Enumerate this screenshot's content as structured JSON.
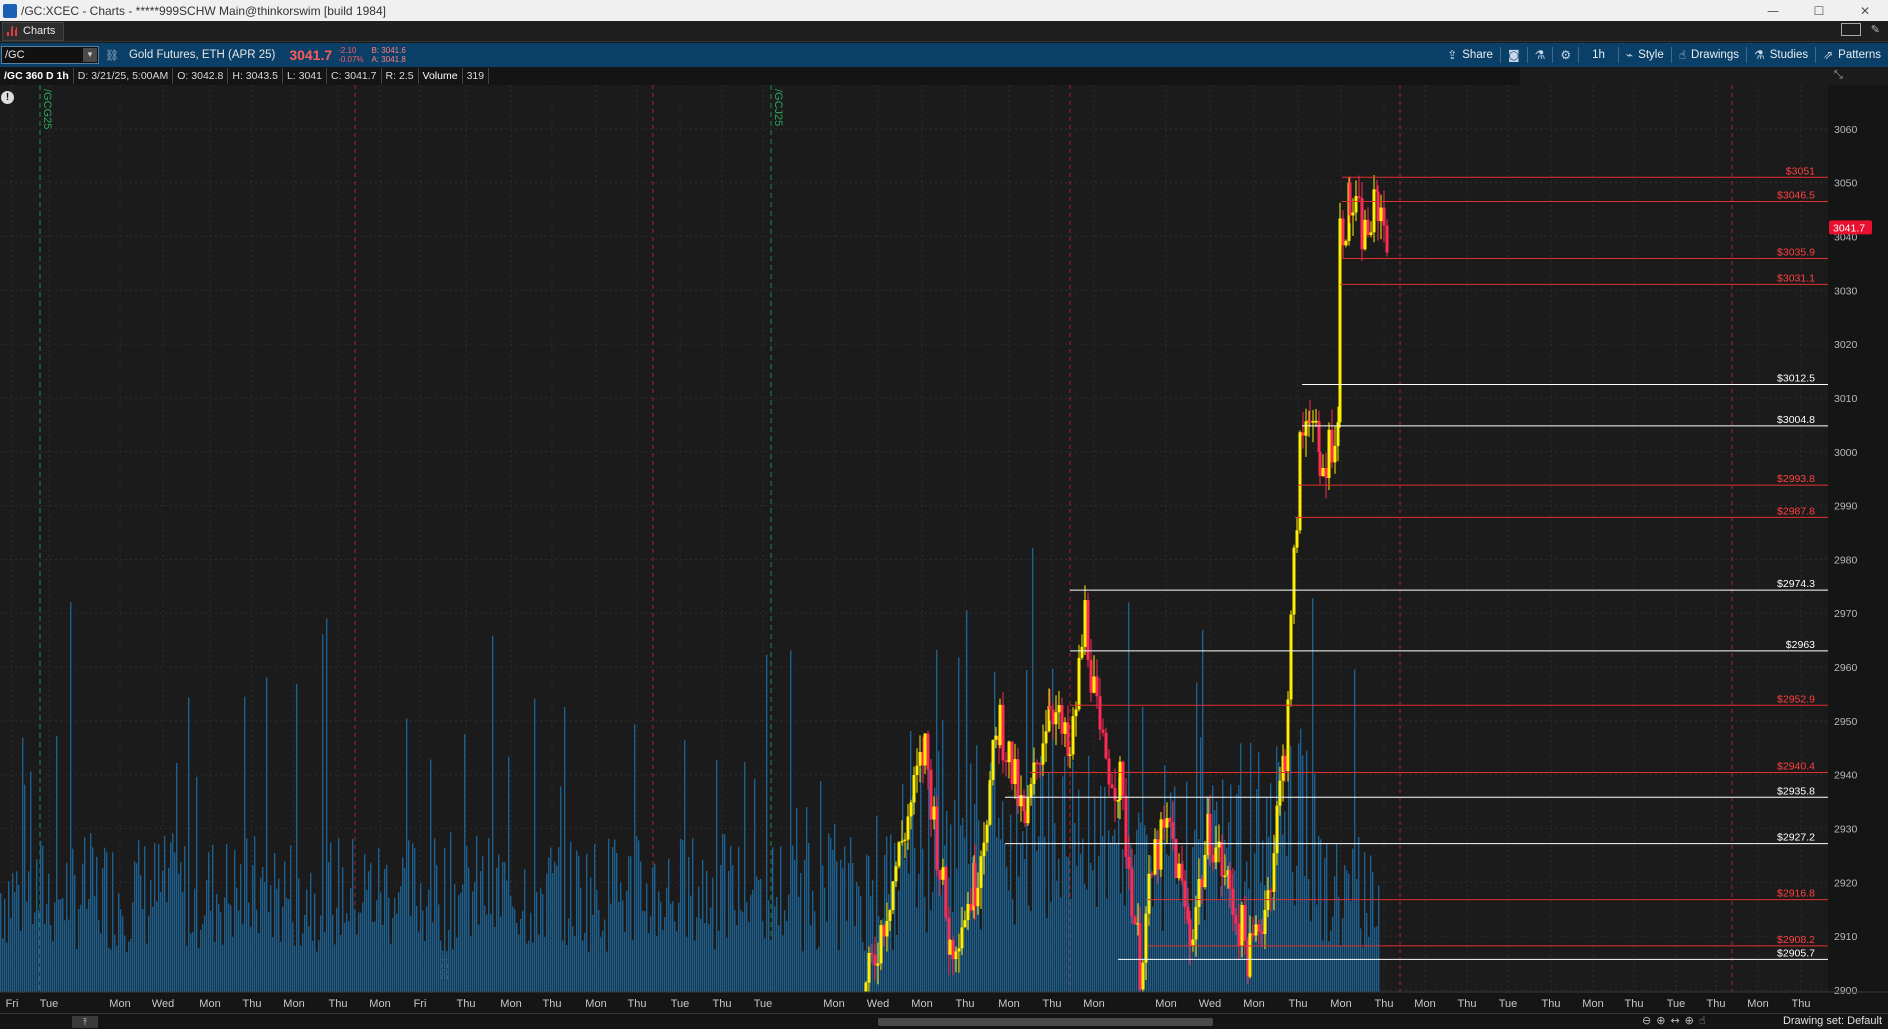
{
  "window": {
    "title": "/GC:XCEC - Charts - *****999SCHW Main@thinkorswim [build 1984]",
    "controls": {
      "minimize": "—",
      "maximize": "☐",
      "close": "✕"
    }
  },
  "tab": {
    "label": "Charts"
  },
  "toolbar": {
    "symbol": "/GC",
    "description": "Gold Futures, ETH (APR 25)",
    "last": "3041.7",
    "change": "-2.10",
    "change_pct": "-0.07%",
    "bid": "B: 3041.6",
    "ask": "A: 3041.8",
    "buttons": {
      "share": "Share",
      "timeframe": "1h",
      "style": "Style",
      "drawings": "Drawings",
      "studies": "Studies",
      "patterns": "Patterns"
    }
  },
  "infobar": {
    "symbol_tf": "/GC 360 D 1h",
    "date": "D: 3/21/25, 5:00AM",
    "open": "O: 3042.8",
    "high": "H: 3043.5",
    "low": "L: 3041",
    "close": "C: 3041.7",
    "range": "R: 2.5",
    "volume_label": "Volume",
    "volume_value": "319"
  },
  "chart_data": {
    "type": "candlestick",
    "y_axis": {
      "min": 2900,
      "max": 3070,
      "step": 10,
      "side": "right"
    },
    "last_price_label": "3041.7",
    "price_lines": [
      {
        "price": 3051,
        "label": "$3051",
        "color": "#e03030"
      },
      {
        "price": 3046.5,
        "label": "$3046.5",
        "color": "#e03030"
      },
      {
        "price": 3035.9,
        "label": "$3035.9",
        "color": "#e03030"
      },
      {
        "price": 3031.1,
        "label": "$3031.1",
        "color": "#e03030"
      },
      {
        "price": 3012.5,
        "label": "$3012.5",
        "color": "#ffffff"
      },
      {
        "price": 3004.8,
        "label": "$3004.8",
        "color": "#ffffff"
      },
      {
        "price": 2993.8,
        "label": "$2993.8",
        "color": "#e03030"
      },
      {
        "price": 2987.8,
        "label": "$2987.8",
        "color": "#e03030"
      },
      {
        "price": 2974.3,
        "label": "$2974.3",
        "color": "#ffffff"
      },
      {
        "price": 2963,
        "label": "$2963",
        "color": "#ffffff"
      },
      {
        "price": 2952.9,
        "label": "$2952.9",
        "color": "#e03030"
      },
      {
        "price": 2940.4,
        "label": "$2940.4",
        "color": "#e03030"
      },
      {
        "price": 2935.8,
        "label": "$2935.8",
        "color": "#ffffff"
      },
      {
        "price": 2927.2,
        "label": "$2927.2",
        "color": "#ffffff"
      },
      {
        "price": 2916.8,
        "label": "$2916.8",
        "color": "#e03030"
      },
      {
        "price": 2908.2,
        "label": "$2908.2",
        "color": "#e03030"
      },
      {
        "price": 2905.7,
        "label": "$2905.7",
        "color": "#ffffff"
      }
    ],
    "x_tick_labels": [
      "Fri",
      "Tue",
      "Mon",
      "Wed",
      "Mon",
      "Thu",
      "Mon",
      "Thu",
      "Mon",
      "Fri",
      "Thu",
      "Mon",
      "Thu",
      "Mon",
      "Thu",
      "Tue",
      "Thu",
      "Tue",
      "Mon",
      "Wed",
      "Mon",
      "Thu",
      "Mon",
      "Thu",
      "Mon",
      "Mon",
      "Wed",
      "Mon",
      "Thu",
      "Mon",
      "Thu",
      "Mon",
      "Thu",
      "Tue",
      "Thu",
      "Mon",
      "Thu",
      "Tue",
      "Thu",
      "Mon",
      "Thu"
    ],
    "rollover_labels": [
      "/GCG25",
      "/GCJ25"
    ],
    "colors": {
      "up": "#ffee00",
      "down": "#ff2a55",
      "volume": "#1d5f8e",
      "background": "#1b1b1b",
      "grid": "#2c2c2c"
    }
  },
  "bottombar": {
    "drawing_set": "Drawing set: Default"
  }
}
